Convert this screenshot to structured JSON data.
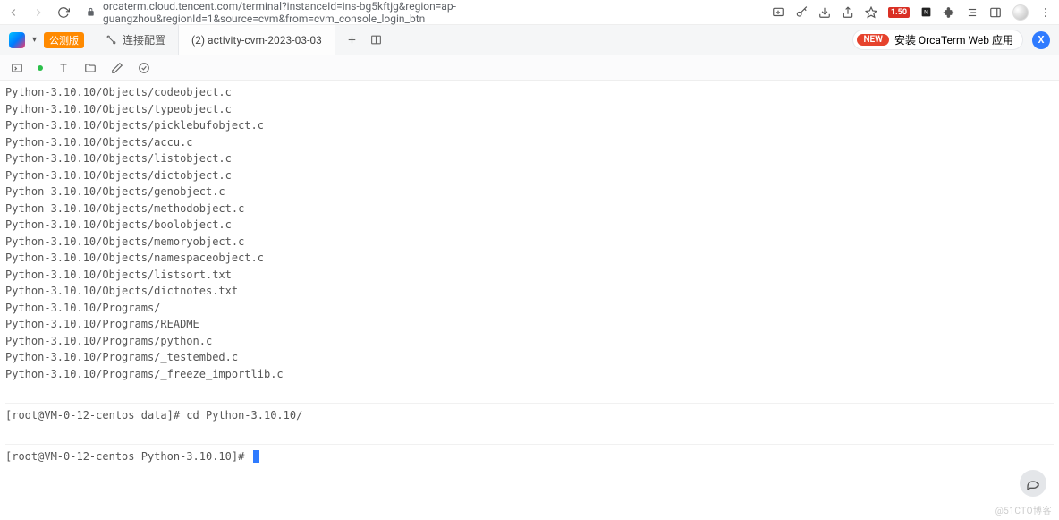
{
  "browser": {
    "url": "orcaterm.cloud.tencent.com/terminal?instanceId=ins-bg5kftjg&region=ap-guangzhou&regionId=1&source=cvm&from=cvm_console_login_btn",
    "ext_badge": "1.50"
  },
  "app": {
    "beta_label": "公测版",
    "conn_config_label": "连接配置",
    "tab_label": "(2) activity-cvm-2023-03-03",
    "install_new": "NEW",
    "install_text": "安装 OrcaTerm Web 应用",
    "blue_badge": "X"
  },
  "terminal": {
    "lines": [
      "Python-3.10.10/Objects/codeobject.c",
      "Python-3.10.10/Objects/typeobject.c",
      "Python-3.10.10/Objects/picklebufobject.c",
      "Python-3.10.10/Objects/accu.c",
      "Python-3.10.10/Objects/listobject.c",
      "Python-3.10.10/Objects/dictobject.c",
      "Python-3.10.10/Objects/genobject.c",
      "Python-3.10.10/Objects/methodobject.c",
      "Python-3.10.10/Objects/boolobject.c",
      "Python-3.10.10/Objects/memoryobject.c",
      "Python-3.10.10/Objects/namespaceobject.c",
      "Python-3.10.10/Objects/listsort.txt",
      "Python-3.10.10/Objects/dictnotes.txt",
      "Python-3.10.10/Programs/",
      "Python-3.10.10/Programs/README",
      "Python-3.10.10/Programs/python.c",
      "Python-3.10.10/Programs/_testembed.c",
      "Python-3.10.10/Programs/_freeze_importlib.c"
    ],
    "prompt1_full": "[root@VM-0-12-centos data]# cd Python-3.10.10/",
    "prompt2_full": "[root@VM-0-12-centos Python-3.10.10]# "
  },
  "watermark": "@51CTO博客"
}
